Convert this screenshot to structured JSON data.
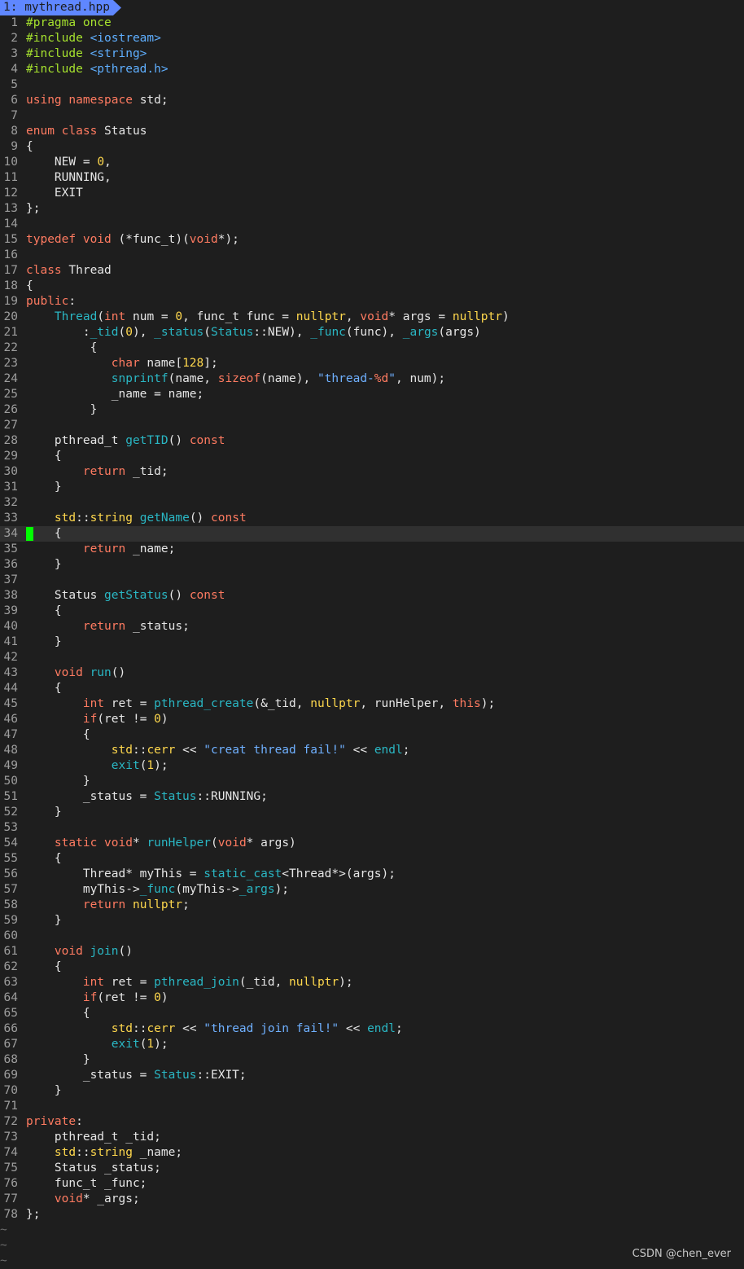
{
  "tab": {
    "label": "1: mythread.hpp"
  },
  "watermark": "CSDN @chen_ever",
  "cursor_line": 34,
  "tilde_rows": 3,
  "lines": [
    [
      [
        "pp",
        "#pragma once"
      ]
    ],
    [
      [
        "pp",
        "#include "
      ],
      [
        "inc",
        "<iostream>"
      ]
    ],
    [
      [
        "pp",
        "#include "
      ],
      [
        "inc",
        "<string>"
      ]
    ],
    [
      [
        "pp",
        "#include "
      ],
      [
        "inc",
        "<pthread.h>"
      ]
    ],
    [],
    [
      [
        "kw",
        "using"
      ],
      [
        "t",
        " "
      ],
      [
        "kw",
        "namespace"
      ],
      [
        "t",
        " std;"
      ]
    ],
    [],
    [
      [
        "kw",
        "enum"
      ],
      [
        "t",
        " "
      ],
      [
        "kw",
        "class"
      ],
      [
        "t",
        " Status"
      ]
    ],
    [
      [
        "t",
        "{"
      ]
    ],
    [
      [
        "t",
        "    NEW = "
      ],
      [
        "num",
        "0"
      ],
      [
        "t",
        ","
      ]
    ],
    [
      [
        "t",
        "    RUNNING,"
      ]
    ],
    [
      [
        "t",
        "    EXIT"
      ]
    ],
    [
      [
        "t",
        "};"
      ]
    ],
    [],
    [
      [
        "kw",
        "typedef"
      ],
      [
        "t",
        " "
      ],
      [
        "ty",
        "void"
      ],
      [
        "t",
        " (*func_t)("
      ],
      [
        "ty",
        "void"
      ],
      [
        "t",
        "*);"
      ]
    ],
    [],
    [
      [
        "kw",
        "class"
      ],
      [
        "t",
        " Thread"
      ]
    ],
    [
      [
        "t",
        "{"
      ]
    ],
    [
      [
        "kw",
        "public"
      ],
      [
        "t",
        ":"
      ]
    ],
    [
      [
        "t",
        "    "
      ],
      [
        "fn",
        "Thread"
      ],
      [
        "t",
        "("
      ],
      [
        "ty",
        "int"
      ],
      [
        "t",
        " num = "
      ],
      [
        "num",
        "0"
      ],
      [
        "t",
        ", func_t func = "
      ],
      [
        "lit",
        "nullptr"
      ],
      [
        "t",
        ", "
      ],
      [
        "ty",
        "void"
      ],
      [
        "t",
        "* args = "
      ],
      [
        "lit",
        "nullptr"
      ],
      [
        "t",
        ")"
      ]
    ],
    [
      [
        "t",
        "        :"
      ],
      [
        "fn",
        "_tid"
      ],
      [
        "t",
        "("
      ],
      [
        "num",
        "0"
      ],
      [
        "t",
        "), "
      ],
      [
        "fn",
        "_status"
      ],
      [
        "t",
        "("
      ],
      [
        "fn",
        "Status"
      ],
      [
        "t",
        "::NEW), "
      ],
      [
        "fn",
        "_func"
      ],
      [
        "t",
        "(func), "
      ],
      [
        "fn",
        "_args"
      ],
      [
        "t",
        "(args)"
      ]
    ],
    [
      [
        "t",
        "         {"
      ]
    ],
    [
      [
        "t",
        "            "
      ],
      [
        "ty",
        "char"
      ],
      [
        "t",
        " name["
      ],
      [
        "num",
        "128"
      ],
      [
        "t",
        "];"
      ]
    ],
    [
      [
        "t",
        "            "
      ],
      [
        "fn",
        "snprintf"
      ],
      [
        "t",
        "(name, "
      ],
      [
        "kw",
        "sizeof"
      ],
      [
        "t",
        "(name), "
      ],
      [
        "str",
        "\"thread-"
      ],
      [
        "fmt",
        "%d"
      ],
      [
        "str",
        "\""
      ],
      [
        "t",
        ", num);"
      ]
    ],
    [
      [
        "t",
        "            _name = name;"
      ]
    ],
    [
      [
        "t",
        "         }"
      ]
    ],
    [],
    [
      [
        "t",
        "    pthread_t "
      ],
      [
        "fn",
        "getTID"
      ],
      [
        "t",
        "() "
      ],
      [
        "kw",
        "const"
      ]
    ],
    [
      [
        "t",
        "    {"
      ]
    ],
    [
      [
        "t",
        "        "
      ],
      [
        "kw",
        "return"
      ],
      [
        "t",
        " _tid;"
      ]
    ],
    [
      [
        "t",
        "    }"
      ]
    ],
    [],
    [
      [
        "t",
        "    "
      ],
      [
        "ns",
        "std"
      ],
      [
        "t",
        "::"
      ],
      [
        "ns",
        "string"
      ],
      [
        "t",
        " "
      ],
      [
        "fn",
        "getName"
      ],
      [
        "t",
        "() "
      ],
      [
        "kw",
        "const"
      ]
    ],
    [
      [
        "t",
        "    {"
      ]
    ],
    [
      [
        "t",
        "        "
      ],
      [
        "kw",
        "return"
      ],
      [
        "t",
        " _name;"
      ]
    ],
    [
      [
        "t",
        "    }"
      ]
    ],
    [],
    [
      [
        "t",
        "    Status "
      ],
      [
        "fn",
        "getStatus"
      ],
      [
        "t",
        "() "
      ],
      [
        "kw",
        "const"
      ]
    ],
    [
      [
        "t",
        "    {"
      ]
    ],
    [
      [
        "t",
        "        "
      ],
      [
        "kw",
        "return"
      ],
      [
        "t",
        " _status;"
      ]
    ],
    [
      [
        "t",
        "    }"
      ]
    ],
    [],
    [
      [
        "t",
        "    "
      ],
      [
        "ty",
        "void"
      ],
      [
        "t",
        " "
      ],
      [
        "fn",
        "run"
      ],
      [
        "t",
        "()"
      ]
    ],
    [
      [
        "t",
        "    {"
      ]
    ],
    [
      [
        "t",
        "        "
      ],
      [
        "ty",
        "int"
      ],
      [
        "t",
        " ret = "
      ],
      [
        "fn",
        "pthread_create"
      ],
      [
        "t",
        "(&_tid, "
      ],
      [
        "lit",
        "nullptr"
      ],
      [
        "t",
        ", runHelper, "
      ],
      [
        "kw",
        "this"
      ],
      [
        "t",
        ");"
      ]
    ],
    [
      [
        "t",
        "        "
      ],
      [
        "kw",
        "if"
      ],
      [
        "t",
        "(ret != "
      ],
      [
        "num",
        "0"
      ],
      [
        "t",
        ")"
      ]
    ],
    [
      [
        "t",
        "        {"
      ]
    ],
    [
      [
        "t",
        "            "
      ],
      [
        "ns",
        "std"
      ],
      [
        "t",
        "::"
      ],
      [
        "ns",
        "cerr"
      ],
      [
        "t",
        " << "
      ],
      [
        "str",
        "\"creat thread fail!\""
      ],
      [
        "t",
        " << "
      ],
      [
        "fn",
        "endl"
      ],
      [
        "t",
        ";"
      ]
    ],
    [
      [
        "t",
        "            "
      ],
      [
        "fn",
        "exit"
      ],
      [
        "t",
        "("
      ],
      [
        "num",
        "1"
      ],
      [
        "t",
        ");"
      ]
    ],
    [
      [
        "t",
        "        }"
      ]
    ],
    [
      [
        "t",
        "        _status = "
      ],
      [
        "fn",
        "Status"
      ],
      [
        "t",
        "::RUNNING;"
      ]
    ],
    [
      [
        "t",
        "    }"
      ]
    ],
    [],
    [
      [
        "t",
        "    "
      ],
      [
        "kw",
        "static"
      ],
      [
        "t",
        " "
      ],
      [
        "ty",
        "void"
      ],
      [
        "t",
        "* "
      ],
      [
        "fn",
        "runHelper"
      ],
      [
        "t",
        "("
      ],
      [
        "ty",
        "void"
      ],
      [
        "t",
        "* args)"
      ]
    ],
    [
      [
        "t",
        "    {"
      ]
    ],
    [
      [
        "t",
        "        Thread* myThis = "
      ],
      [
        "fn",
        "static_cast"
      ],
      [
        "t",
        "<Thread*>(args);"
      ]
    ],
    [
      [
        "t",
        "        myThis->"
      ],
      [
        "fn",
        "_func"
      ],
      [
        "t",
        "(myThis->"
      ],
      [
        "fn",
        "_args"
      ],
      [
        "t",
        ");"
      ]
    ],
    [
      [
        "t",
        "        "
      ],
      [
        "kw",
        "return"
      ],
      [
        "t",
        " "
      ],
      [
        "lit",
        "nullptr"
      ],
      [
        "t",
        ";"
      ]
    ],
    [
      [
        "t",
        "    }"
      ]
    ],
    [],
    [
      [
        "t",
        "    "
      ],
      [
        "ty",
        "void"
      ],
      [
        "t",
        " "
      ],
      [
        "fn",
        "join"
      ],
      [
        "t",
        "()"
      ]
    ],
    [
      [
        "t",
        "    {"
      ]
    ],
    [
      [
        "t",
        "        "
      ],
      [
        "ty",
        "int"
      ],
      [
        "t",
        " ret = "
      ],
      [
        "fn",
        "pthread_join"
      ],
      [
        "t",
        "(_tid, "
      ],
      [
        "lit",
        "nullptr"
      ],
      [
        "t",
        ");"
      ]
    ],
    [
      [
        "t",
        "        "
      ],
      [
        "kw",
        "if"
      ],
      [
        "t",
        "(ret != "
      ],
      [
        "num",
        "0"
      ],
      [
        "t",
        ")"
      ]
    ],
    [
      [
        "t",
        "        {"
      ]
    ],
    [
      [
        "t",
        "            "
      ],
      [
        "ns",
        "std"
      ],
      [
        "t",
        "::"
      ],
      [
        "ns",
        "cerr"
      ],
      [
        "t",
        " << "
      ],
      [
        "str",
        "\"thread join fail!\""
      ],
      [
        "t",
        " << "
      ],
      [
        "fn",
        "endl"
      ],
      [
        "t",
        ";"
      ]
    ],
    [
      [
        "t",
        "            "
      ],
      [
        "fn",
        "exit"
      ],
      [
        "t",
        "("
      ],
      [
        "num",
        "1"
      ],
      [
        "t",
        ");"
      ]
    ],
    [
      [
        "t",
        "        }"
      ]
    ],
    [
      [
        "t",
        "        _status = "
      ],
      [
        "fn",
        "Status"
      ],
      [
        "t",
        "::EXIT;"
      ]
    ],
    [
      [
        "t",
        "    }"
      ]
    ],
    [],
    [
      [
        "kw",
        "private"
      ],
      [
        "t",
        ":"
      ]
    ],
    [
      [
        "t",
        "    pthread_t _tid;"
      ]
    ],
    [
      [
        "t",
        "    "
      ],
      [
        "ns",
        "std"
      ],
      [
        "t",
        "::"
      ],
      [
        "ns",
        "string"
      ],
      [
        "t",
        " _name;"
      ]
    ],
    [
      [
        "t",
        "    Status _status;"
      ]
    ],
    [
      [
        "t",
        "    func_t _func;"
      ]
    ],
    [
      [
        "t",
        "    "
      ],
      [
        "ty",
        "void"
      ],
      [
        "t",
        "* _args;"
      ]
    ],
    [
      [
        "t",
        "};"
      ]
    ]
  ]
}
